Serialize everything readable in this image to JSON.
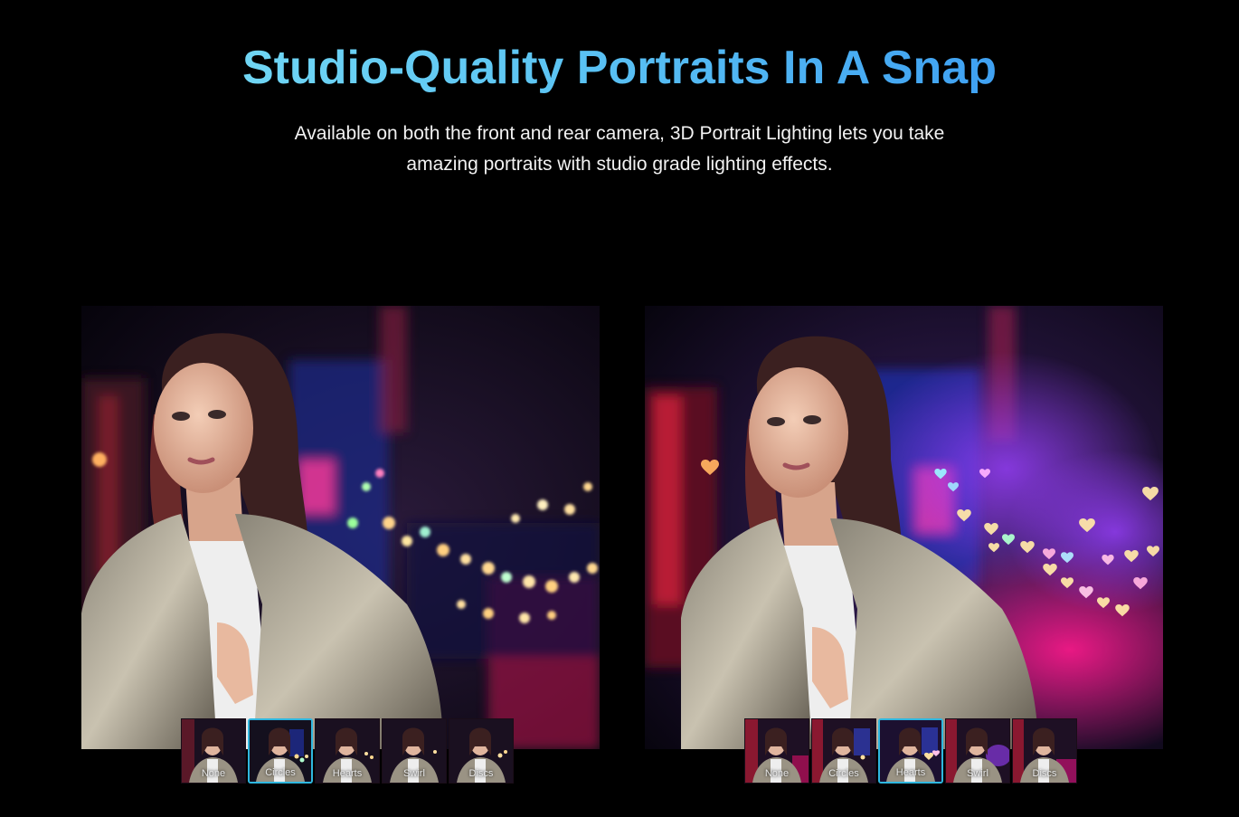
{
  "hero": {
    "title": "Studio-Quality Portraits In A Snap",
    "subtitle_line1": "Available on both the front and rear camera, 3D Portrait Lighting lets you take",
    "subtitle_line2": "amazing portraits with studio grade lighting effects."
  },
  "colors": {
    "accent": "#2fb7df",
    "title_start": "#7fe3f5",
    "title_end": "#2f8df2",
    "background": "#000000"
  },
  "left_panel": {
    "effects": [
      "None",
      "Circles",
      "Hearts",
      "Swirl",
      "Discs"
    ],
    "selected": "Circles"
  },
  "right_panel": {
    "effects": [
      "None",
      "Circles",
      "Hearts",
      "Swirl",
      "Discs"
    ],
    "selected": "Hearts"
  }
}
